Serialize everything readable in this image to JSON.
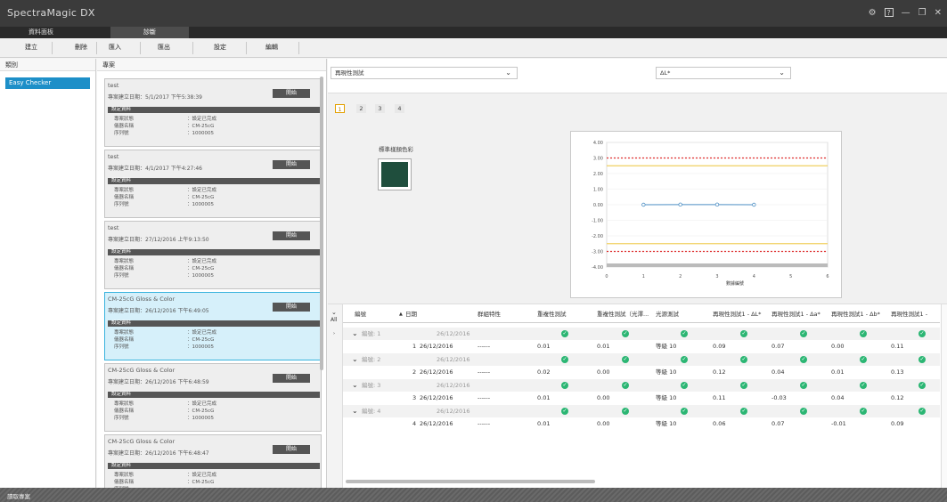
{
  "app": {
    "title": "SpectraMagic DX"
  },
  "window_icons": [
    "gear-icon",
    "help-icon",
    "minimize-icon",
    "restore-icon",
    "close-icon"
  ],
  "tabs": [
    {
      "label": "資料面板",
      "active": false
    },
    {
      "label": "診斷",
      "active": true
    }
  ],
  "toolbar": {
    "create": "建立",
    "delete": "刪除",
    "import": "匯入",
    "export": "匯出",
    "settings": "設定",
    "edit": "編輯"
  },
  "categories": {
    "header": "類別",
    "items": [
      "Easy Checker"
    ]
  },
  "projects": {
    "header": "專案",
    "start_label": "開始",
    "settings_header": "設定資料",
    "row_labels": {
      "status": "專案狀態",
      "instrument": "儀器名稱",
      "serial": "序列號"
    },
    "cards": [
      {
        "name": "test",
        "created": "專案建立日期：5/1/2017 下午5:38:39",
        "status": "：設定已完成",
        "instrument": "：CM-25cG",
        "serial": "：1000005",
        "selected": false
      },
      {
        "name": "test",
        "created": "專案建立日期：4/1/2017 下午4:27:46",
        "status": "：設定已完成",
        "instrument": "：CM-25cG",
        "serial": "：1000005",
        "selected": false
      },
      {
        "name": "test",
        "created": "專案建立日期：27/12/2016 上午9:13:50",
        "status": "：設定已完成",
        "instrument": "：CM-25cG",
        "serial": "：1000005",
        "selected": false
      },
      {
        "name": "CM-25cG Gloss & Color",
        "created": "專案建立日期：26/12/2016 下午6:49:05",
        "status": "：設定已完成",
        "instrument": "：CM-25cG",
        "serial": "：1000005",
        "selected": true
      },
      {
        "name": "CM-25cG Gloss & Color",
        "created": "專案建立日期：26/12/2016 下午6:48:59",
        "status": "：設定已完成",
        "instrument": "：CM-25cG",
        "serial": "：1000005",
        "selected": false
      },
      {
        "name": "CM-25cG Gloss & Color",
        "created": "專案建立日期：26/12/2016 下午6:48:47",
        "status": "：設定已完成",
        "instrument": "：CM-25cG",
        "serial": "",
        "selected": false
      }
    ]
  },
  "filters": {
    "test_select": "再現性測試",
    "metric_select": "ΔL*"
  },
  "pages": [
    "1",
    "2",
    "3",
    "4"
  ],
  "swatch": {
    "label": "標準樣顏色彩",
    "color": "#1f4e3d"
  },
  "chart_data": {
    "type": "line",
    "x": [
      1,
      2,
      3,
      4
    ],
    "values": [
      0.0,
      0.01,
      0.01,
      0.0
    ],
    "xlabel": "數據編號",
    "ylabel": "",
    "xlim": [
      0,
      6
    ],
    "ylim": [
      -4.0,
      4.0
    ],
    "yticks": [
      "4.00",
      "3.00",
      "2.00",
      "1.00",
      "0.00",
      "-1.00",
      "-2.00",
      "-3.00",
      "-4.00"
    ],
    "xticks": [
      "0",
      "1",
      "2",
      "3",
      "4",
      "5",
      "6"
    ],
    "limit_lines": [
      {
        "value": 3,
        "color": "#e03030"
      },
      {
        "value": 2.5,
        "color": "#f0d060"
      },
      {
        "value": -2.5,
        "color": "#f0d060"
      },
      {
        "value": -3,
        "color": "#e03030"
      }
    ],
    "series_color": "#4d8fc4"
  },
  "grid": {
    "all_label": "All",
    "columns": [
      "編號",
      "日期",
      "群組特性",
      "重複性測試",
      "重複性測試（光澤...",
      "光源測試",
      "再現性測試1 - ΔL*",
      "再現性測試1 - Δa*",
      "再現性測試1 - Δb*",
      "再現性測試1 -"
    ],
    "groups": [
      {
        "label": "編號: 1",
        "date": "26/12/2016",
        "row": {
          "no": "1",
          "date": "26/12/2016",
          "char": "------",
          "rep": "0.01",
          "gloss": "0.01",
          "light": "等級 10",
          "dl": "0.09",
          "da": "0.07",
          "db": "0.00",
          "x": "0.11"
        }
      },
      {
        "label": "編號: 2",
        "date": "26/12/2016",
        "row": {
          "no": "2",
          "date": "26/12/2016",
          "char": "------",
          "rep": "0.02",
          "gloss": "0.00",
          "light": "等級 10",
          "dl": "0.12",
          "da": "0.04",
          "db": "0.01",
          "x": "0.13"
        }
      },
      {
        "label": "編號: 3",
        "date": "26/12/2016",
        "row": {
          "no": "3",
          "date": "26/12/2016",
          "char": "------",
          "rep": "0.01",
          "gloss": "0.00",
          "light": "等級 10",
          "dl": "0.11",
          "da": "-0.03",
          "db": "0.04",
          "x": "0.12"
        }
      },
      {
        "label": "編號: 4",
        "date": "26/12/2016",
        "row": {
          "no": "4",
          "date": "26/12/2016",
          "char": "------",
          "rep": "0.01",
          "gloss": "0.00",
          "light": "等級 10",
          "dl": "0.06",
          "da": "0.07",
          "db": "-0.01",
          "x": "0.09"
        }
      }
    ]
  },
  "status": {
    "text": "讀取專案"
  }
}
